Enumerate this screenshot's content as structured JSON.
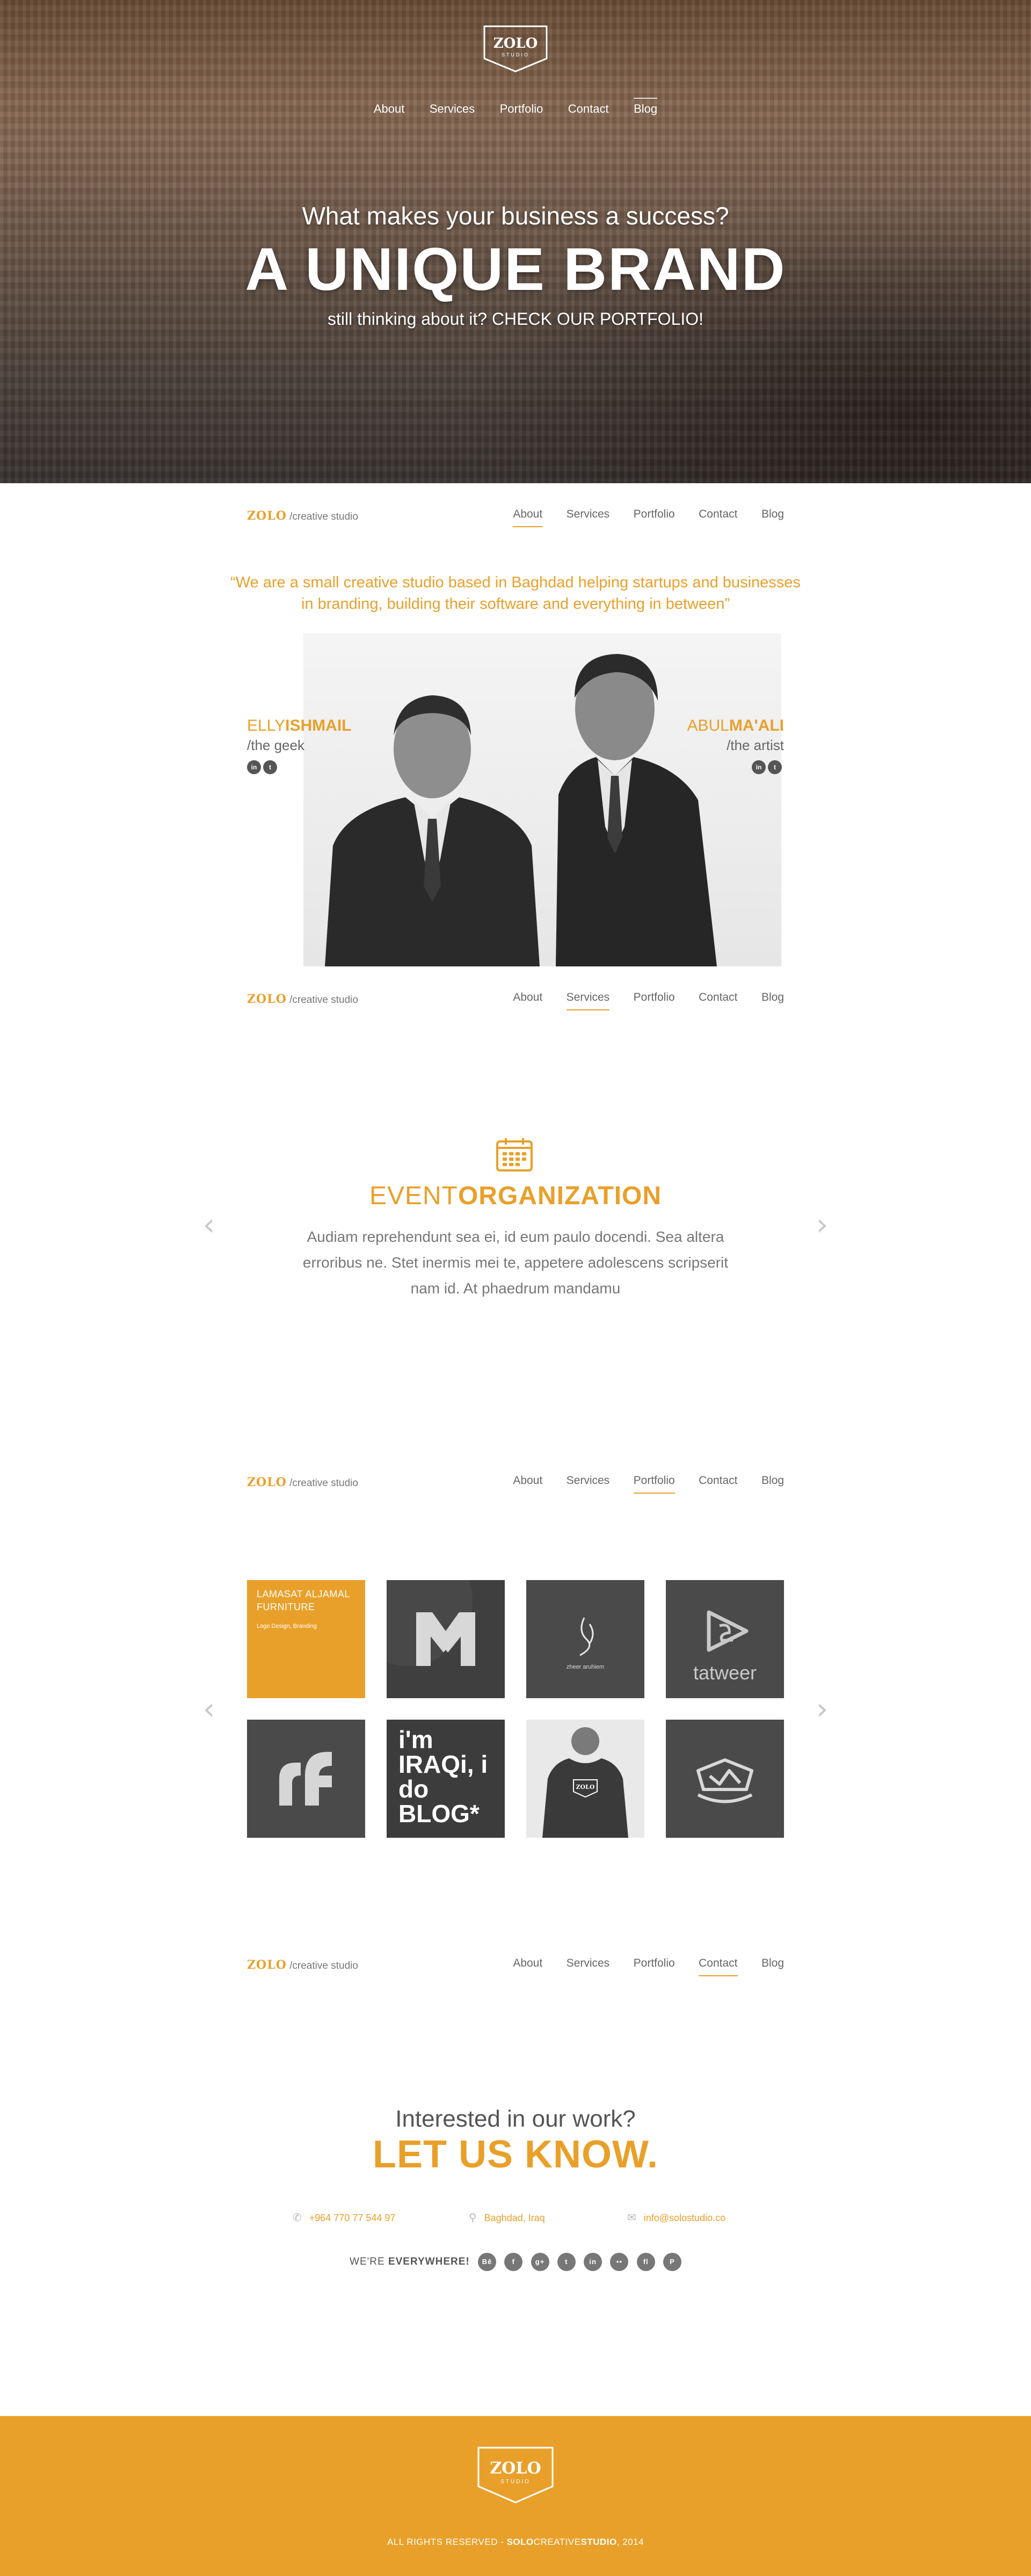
{
  "hero": {
    "logo_text": "ZOLO",
    "logo_sub": "STUDIO",
    "nav": [
      "About",
      "Services",
      "Portfolio",
      "Contact",
      "Blog"
    ],
    "active_nav": "Blog",
    "question": "What makes your business a success?",
    "headline": "A UNIQUE BRAND",
    "subline": "still thinking about it? CHECK OUR PORTFOLIO!"
  },
  "section_nav": {
    "brand": "ZOLO",
    "brand_suffix": "/creative studio",
    "items": [
      "About",
      "Services",
      "Portfolio",
      "Contact",
      "Blog"
    ]
  },
  "about": {
    "quote": "“We are a small creative studio based in Baghdad helping startups and businesses in branding, building their software and everything in between”",
    "members": [
      {
        "first": "ELLY",
        "last": "ISHMAIL",
        "role": "/the geek",
        "socials": [
          "in",
          "t"
        ]
      },
      {
        "first": "ABUL",
        "last": "MA'ALI",
        "role": "/the artist",
        "socials": [
          "in",
          "t"
        ]
      }
    ]
  },
  "services": {
    "icon": "calendar-icon",
    "title_light": "EVENT",
    "title_bold": "ORGANIZATION",
    "description": "Audiam reprehendunt sea ei, id eum paulo docendi. Sea altera erroribus ne. Stet inermis mei te, appetere adolescens scripserit nam id. At phaedrum mandamu",
    "prev": "‹",
    "next": "›"
  },
  "portfolio": {
    "tiles": [
      {
        "title": "LAMASAT ALJAMAL FURNITURE",
        "sub": "Logo Design, Branding",
        "style": "orange"
      },
      {
        "title": "M",
        "sub": "",
        "style": "dark"
      },
      {
        "title": "zheer",
        "sub": "zheer aruhiem",
        "style": "dark"
      },
      {
        "title": "tatweer",
        "sub": "",
        "style": "dark"
      },
      {
        "title": "rf",
        "sub": "",
        "style": "dark"
      },
      {
        "title": "i'm IRAQi, i do BLOG*",
        "sub": "",
        "style": "dark"
      },
      {
        "title": "ZOLO",
        "sub": "",
        "style": "dark"
      },
      {
        "title": "scale",
        "sub": "",
        "style": "dark"
      }
    ],
    "prev": "‹",
    "next": "›"
  },
  "contact": {
    "question": "Interested in our work?",
    "cta": "LET US KNOW.",
    "phone": "+964 770 77 544 97",
    "location": "Baghdad, Iraq",
    "email": "info@solostudio.co",
    "everywhere_light": "WE'RE",
    "everywhere_bold": "EVERYWHERE!",
    "socials": [
      "Bē",
      "f",
      "g+",
      "t",
      "in",
      "••",
      "fl",
      "P"
    ]
  },
  "footer": {
    "logo_text": "ZOLO",
    "logo_sub": "STUDIO",
    "copy_prefix": "ALL RIGHTS RESERVED -",
    "copy_brand_bold": "SOLO",
    "copy_brand_light": "CREATIVE",
    "copy_brand_bold2": "STUDIO",
    "copy_year": ", 2014"
  },
  "colors": {
    "accent": "#e9a02a",
    "text": "#555555",
    "tile_dark": "#4a4a4a"
  }
}
